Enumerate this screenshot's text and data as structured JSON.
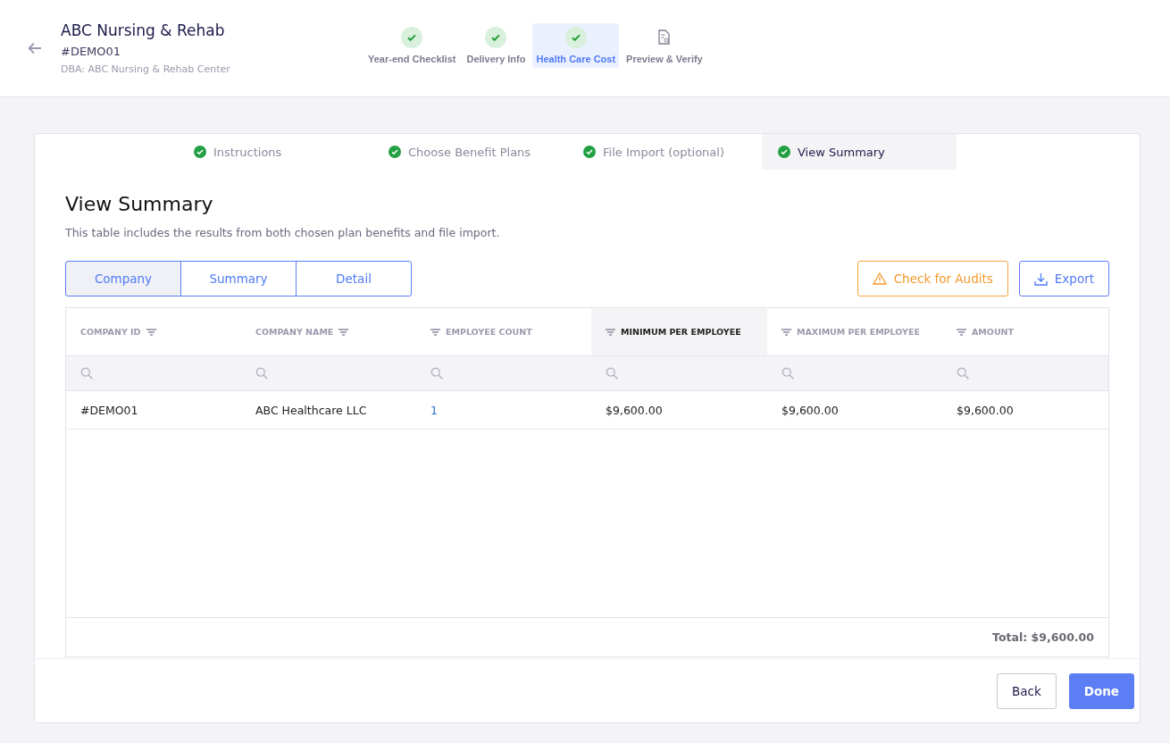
{
  "header": {
    "title": "ABC Nursing & Rehab",
    "code": "#DEMO01",
    "dba": "DBA: ABC Nursing & Rehab Center"
  },
  "steps": [
    {
      "label": "Year-end Checklist",
      "done": true,
      "selected": false
    },
    {
      "label": "Delivery Info",
      "done": true,
      "selected": false
    },
    {
      "label": "Health Care Cost",
      "done": true,
      "selected": true
    },
    {
      "label": "Preview & Verify",
      "done": false,
      "selected": false
    }
  ],
  "substeps": [
    {
      "label": "Instructions",
      "selected": false
    },
    {
      "label": "Choose Benefit Plans",
      "selected": false
    },
    {
      "label": "File Import (optional)",
      "selected": false
    },
    {
      "label": "View Summary",
      "selected": true
    }
  ],
  "section": {
    "title": "View Summary",
    "description": "This table includes the results from both chosen plan benefits and file import."
  },
  "view_tabs": [
    {
      "label": "Company",
      "selected": true
    },
    {
      "label": "Summary",
      "selected": false
    },
    {
      "label": "Detail",
      "selected": false
    }
  ],
  "actions": [
    {
      "label": "Check for Audits",
      "kind": "warning"
    },
    {
      "label": "Export",
      "kind": "export"
    }
  ],
  "table": {
    "columns": [
      {
        "label": "COMPANY ID",
        "kind": "filter-after",
        "selected": false
      },
      {
        "label": "COMPANY NAME",
        "kind": "filter-after",
        "selected": false
      },
      {
        "label": "EMPLOYEE COUNT",
        "kind": "filter-before",
        "selected": false
      },
      {
        "label": "MINIMUM PER EMPLOYEE",
        "kind": "filter-before",
        "selected": true
      },
      {
        "label": "MAXIMUM PER EMPLOYEE",
        "kind": "filter-before",
        "selected": false
      },
      {
        "label": "AMOUNT",
        "kind": "filter-before",
        "selected": false
      }
    ],
    "rows": [
      [
        {
          "text": "#DEMO01",
          "kind": "text"
        },
        {
          "text": "ABC Healthcare LLC",
          "kind": "text"
        },
        {
          "text": "1",
          "kind": "link"
        },
        {
          "text": "$9,600.00",
          "kind": "text"
        },
        {
          "text": "$9,600.00",
          "kind": "text"
        },
        {
          "text": "$9,600.00",
          "kind": "text"
        }
      ]
    ],
    "total": "Total: $9,600.00"
  },
  "footer": {
    "buttons": [
      {
        "label": "Back",
        "kind": "secondary"
      },
      {
        "label": "Done",
        "kind": "primary"
      }
    ]
  }
}
